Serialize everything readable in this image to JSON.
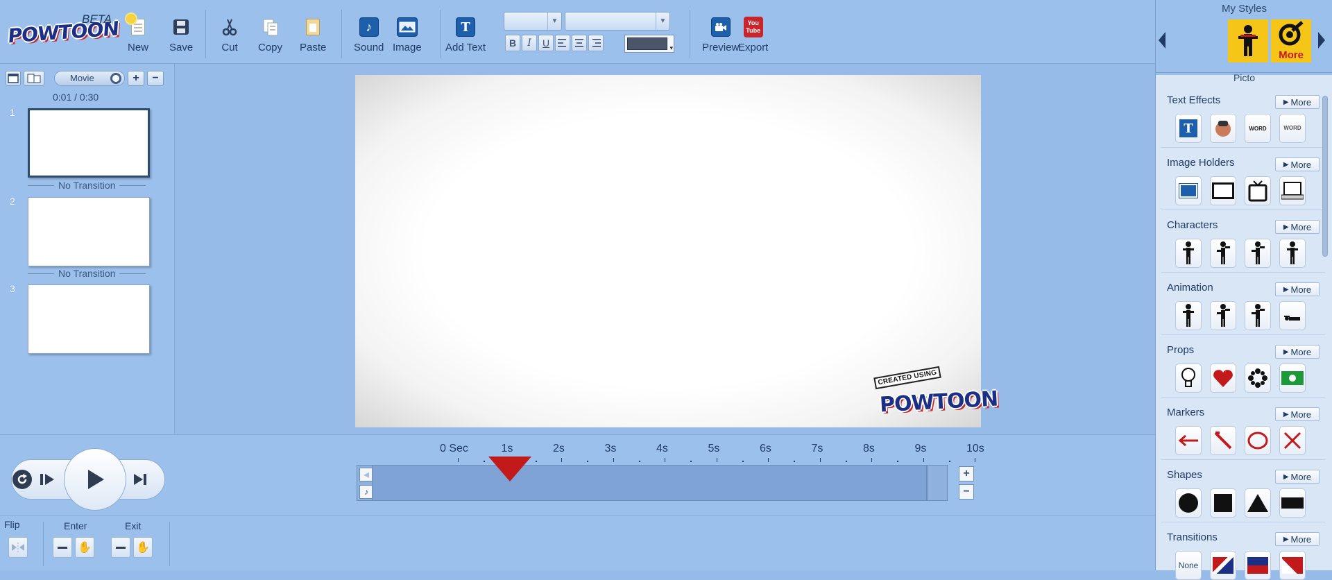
{
  "app": {
    "logo_text": "POWTOON",
    "beta": "BETA"
  },
  "toolbar": {
    "new": "New",
    "save": "Save",
    "cut": "Cut",
    "copy": "Copy",
    "paste": "Paste",
    "sound": "Sound",
    "image": "Image",
    "add_text": "Add Text",
    "preview": "Preview",
    "export": "Export",
    "youtube_top": "You",
    "youtube_bottom": "Tube",
    "format": {
      "bold": "B",
      "italic": "I",
      "underline": "U"
    }
  },
  "slides_panel": {
    "mode_label": "Movie",
    "time": "0:01 / 0:30",
    "slides": [
      {
        "number": "1",
        "selected": true
      },
      {
        "number": "2",
        "selected": false
      },
      {
        "number": "3",
        "selected": false
      }
    ],
    "transitions": [
      "No Transition",
      "No Transition"
    ]
  },
  "stage": {
    "stamp_top": "CREATED USING",
    "stamp_brand": "POWTOON"
  },
  "timeline": {
    "ruler_labels": [
      "0 Sec",
      "1s",
      "2s",
      "3s",
      "4s",
      "5s",
      "6s",
      "7s",
      "8s",
      "9s",
      "10s"
    ],
    "playhead_seconds": 1
  },
  "controls": {
    "flip": "Flip",
    "enter": "Enter",
    "exit": "Exit"
  },
  "right_panel": {
    "header": "My Styles",
    "style_more": "More",
    "current_style": "Picto",
    "more_label": "More",
    "categories": [
      {
        "title": "Text Effects"
      },
      {
        "title": "Image Holders"
      },
      {
        "title": "Characters"
      },
      {
        "title": "Animation"
      },
      {
        "title": "Props"
      },
      {
        "title": "Markers"
      },
      {
        "title": "Shapes"
      },
      {
        "title": "Transitions"
      }
    ],
    "text_effect_tiles": [
      "T",
      "",
      "WORD",
      "WORD"
    ],
    "transition_tile_none": "None"
  },
  "colors": {
    "background": "#97bbe8",
    "accent_red": "#c21a1a",
    "brand_navy": "#1b2f86",
    "panel": "#d9e6f5"
  }
}
